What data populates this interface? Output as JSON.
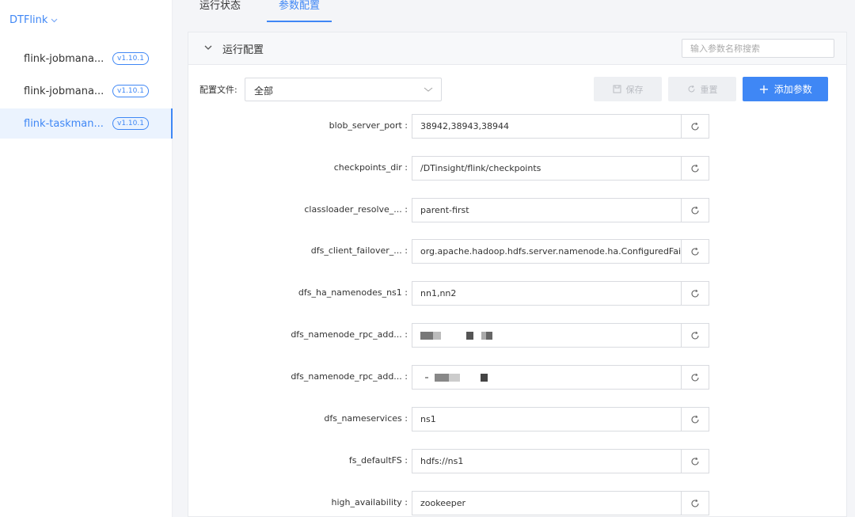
{
  "sidebar": {
    "app_title": "DTFlink",
    "items": [
      {
        "label": "flink-jobmana...",
        "version": "v1.10.1",
        "active": false
      },
      {
        "label": "flink-jobmana...",
        "version": "v1.10.1",
        "active": false
      },
      {
        "label": "flink-taskman...",
        "version": "v1.10.1",
        "active": true
      }
    ]
  },
  "tabs": [
    {
      "label": "运行状态",
      "active": false
    },
    {
      "label": "参数配置",
      "active": true
    }
  ],
  "panel": {
    "title": "运行配置",
    "search_placeholder": "输入参数名称搜索",
    "config_file_label": "配置文件:",
    "config_file_value": "全部",
    "save_label": "保存",
    "reset_label": "重置",
    "add_label": "添加参数"
  },
  "params": [
    {
      "key": "blob_server_port :",
      "value": "38942,38943,38944"
    },
    {
      "key": "checkpoints_dir :",
      "value": "/DTinsight/flink/checkpoints"
    },
    {
      "key": "classloader_resolve_... :",
      "value": "parent-first"
    },
    {
      "key": "dfs_client_failover_... :",
      "value": "org.apache.hadoop.hdfs.server.namenode.ha.ConfiguredFailoverProxyProvider"
    },
    {
      "key": "dfs_ha_namenodes_ns1 :",
      "value": "nn1,nn2"
    },
    {
      "key": "dfs_namenode_rpc_add... :",
      "value": ""
    },
    {
      "key": "dfs_namenode_rpc_add... :",
      "value": ""
    },
    {
      "key": "dfs_nameservices :",
      "value": "ns1"
    },
    {
      "key": "fs_defaultFS :",
      "value": "hdfs://ns1"
    },
    {
      "key": "high_availability :",
      "value": "zookeeper"
    }
  ],
  "colors": {
    "accent": "#3f87f5",
    "disabled_bg": "#eef0f3"
  }
}
